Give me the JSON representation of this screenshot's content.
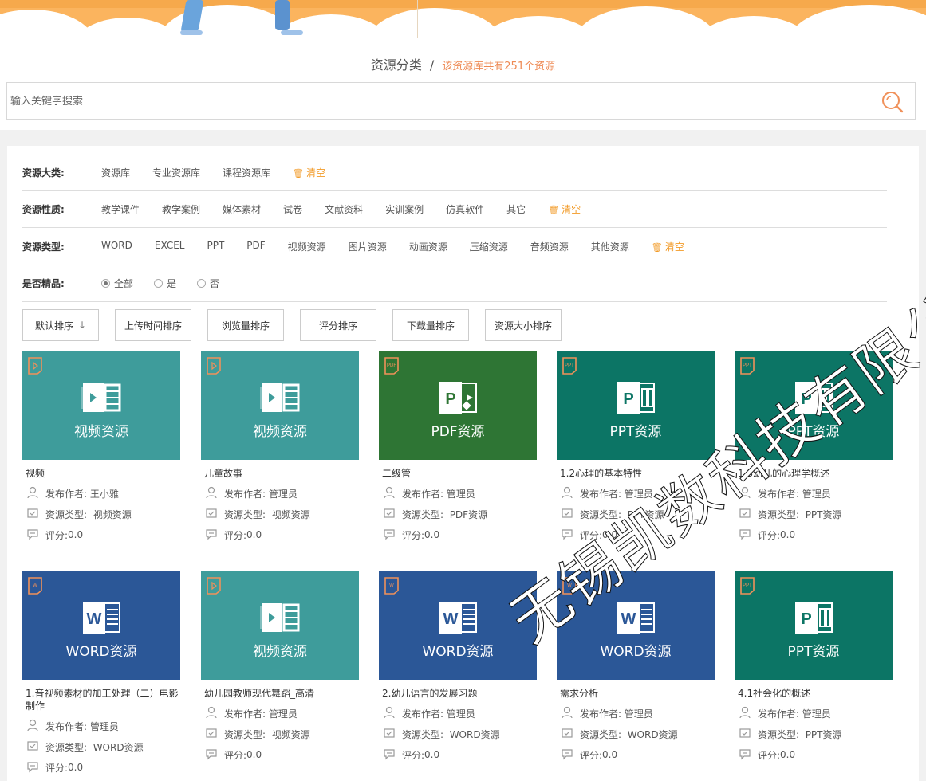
{
  "header": {
    "title": "资源分类",
    "separator": "/",
    "subtitle": "该资源库共有251个资源"
  },
  "search": {
    "placeholder": "输入关键字搜索",
    "icon": "search-icon"
  },
  "filters": [
    {
      "label": "资源大类:",
      "options": [
        "资源库",
        "专业资源库",
        "课程资源库"
      ],
      "clear": "清空"
    },
    {
      "label": "资源性质:",
      "options": [
        "教学课件",
        "教学案例",
        "媒体素材",
        "试卷",
        "文献资料",
        "实训案例",
        "仿真软件",
        "其它"
      ],
      "clear": "清空"
    },
    {
      "label": "资源类型:",
      "options": [
        "WORD",
        "EXCEL",
        "PPT",
        "PDF",
        "视频资源",
        "图片资源",
        "动画资源",
        "压缩资源",
        "音频资源",
        "其他资源"
      ],
      "clear": "清空"
    }
  ],
  "premium": {
    "label": "是否精品:",
    "options": [
      "全部",
      "是",
      "否"
    ],
    "selected": "全部"
  },
  "sorts": [
    "默认排序",
    "上传时间排序",
    "浏览量排序",
    "评分排序",
    "下载量排序",
    "资源大小排序"
  ],
  "sort_default_arrow": "↓",
  "meta_labels": {
    "author": "发布作者:",
    "type": "资源类型:",
    "score": "评分:"
  },
  "colors": {
    "video": "#3e9c9b",
    "pdf": "#2e7534",
    "ppt": "#0c7565",
    "word": "#2b5797",
    "accent": "#f29b28"
  },
  "cards": [
    {
      "kind": "video",
      "caption": "视频资源",
      "title": "视频",
      "author": "王小雅",
      "type": "视频资源",
      "score": "0.0"
    },
    {
      "kind": "video",
      "caption": "视频资源",
      "title": "儿童故事",
      "author": "管理员",
      "type": "视频资源",
      "score": "0.0"
    },
    {
      "kind": "pdf",
      "caption": "PDF资源",
      "title": "二级管",
      "author": "管理员",
      "type": "PDF资源",
      "score": "0.0"
    },
    {
      "kind": "ppt",
      "caption": "PPT资源",
      "title": "1.2心理的基本特性",
      "author": "管理员",
      "type": "PPT资源",
      "score": "0.0"
    },
    {
      "kind": "ppt",
      "caption": "PPT资源",
      "title": "1.3幼儿的心理学概述",
      "author": "管理员",
      "type": "PPT资源",
      "score": "0.0"
    },
    {
      "kind": "word",
      "caption": "WORD资源",
      "title": "1.音视频素材的加工处理（二）电影制作",
      "author": "管理员",
      "type": "WORD资源",
      "score": "0.0"
    },
    {
      "kind": "video",
      "caption": "视频资源",
      "title": "幼儿园教师现代舞蹈_高清",
      "author": "管理员",
      "type": "视频资源",
      "score": "0.0"
    },
    {
      "kind": "word",
      "caption": "WORD资源",
      "title": "2.幼儿语言的发展习题",
      "author": "管理员",
      "type": "WORD资源",
      "score": "0.0"
    },
    {
      "kind": "word",
      "caption": "WORD资源",
      "title": "需求分析",
      "author": "管理员",
      "type": "WORD资源",
      "score": "0.0"
    },
    {
      "kind": "ppt",
      "caption": "PPT资源",
      "title": "4.1社会化的概述",
      "author": "管理员",
      "type": "PPT资源",
      "score": "0.0"
    }
  ],
  "watermark": "无锡凯数科技有限公司"
}
